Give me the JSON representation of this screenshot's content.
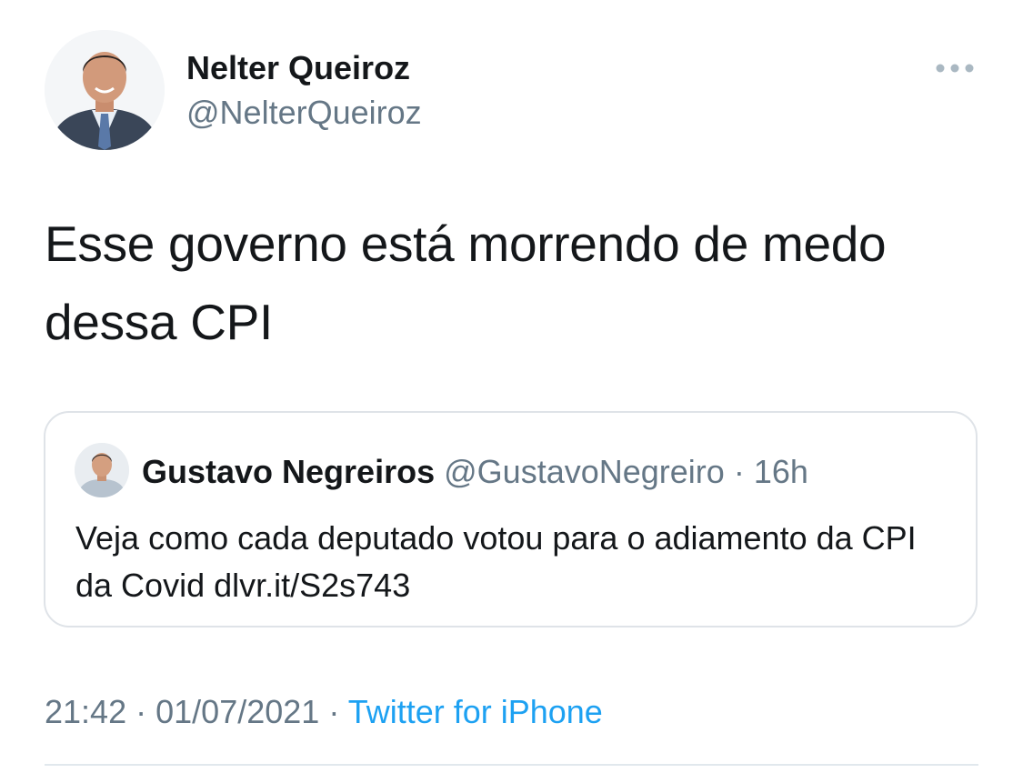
{
  "author": {
    "name": "Nelter Queiroz",
    "handle": "@NelterQueiroz"
  },
  "tweet": {
    "text": "Esse governo está morrendo de medo dessa CPI"
  },
  "quoted_tweet": {
    "name": "Gustavo Negreiros",
    "handle": "@GustavoNegreiro",
    "separator": "·",
    "time": "16h",
    "text": "Veja como cada deputado votou para o adiamento da CPI da Covid dlvr.it/S2s743"
  },
  "meta": {
    "time": "21:42",
    "date": "01/07/2021",
    "separator": "·",
    "source": "Twitter for iPhone"
  },
  "icons": {
    "more": "more-horizontal-icon",
    "author_avatar": "avatar-photo",
    "quote_avatar": "avatar-photo"
  },
  "colors": {
    "text": "#14171a",
    "secondary": "#657786",
    "link": "#1da1f2",
    "border": "#dfe3e8"
  }
}
